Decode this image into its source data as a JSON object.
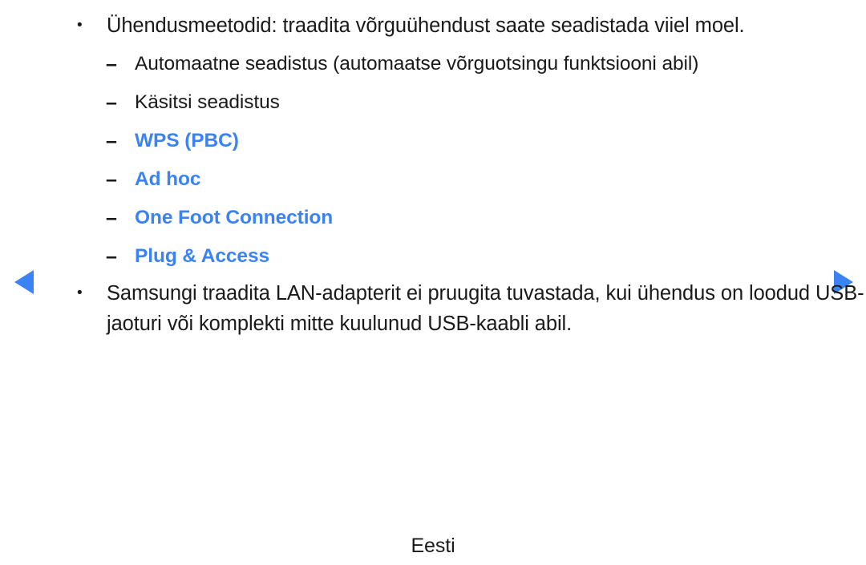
{
  "page": {
    "language_footer": "Eesti",
    "background_color": "#ffffff",
    "text_color": "#1a1a1a",
    "highlight_color": "#3b82f5"
  },
  "navigation": {
    "prev_icon": "triangle-left-icon",
    "next_icon": "triangle-right-icon"
  },
  "content": {
    "intro_bullet": {
      "marker": "•",
      "text": "Ühendusmeetodid: traadita võrguühendust saate seadistada viiel moel."
    },
    "sub_items": [
      {
        "marker": "–",
        "text": "Automaatne seadistus (automaatse võrguotsingu funktsiooni abil)",
        "highlighted": false
      },
      {
        "marker": "–",
        "text": "Käsitsi seadistus",
        "highlighted": false
      },
      {
        "marker": "–",
        "text": "WPS (PBC)",
        "highlighted": true
      },
      {
        "marker": "–",
        "text": "Ad hoc",
        "highlighted": true
      },
      {
        "marker": "–",
        "text": "One Foot Connection",
        "highlighted": true
      },
      {
        "marker": "–",
        "text": "Plug & Access",
        "highlighted": true
      }
    ],
    "note_bullet": {
      "marker": "•",
      "text": "Samsungi traadita LAN-adapterit ei pruugita tuvastada, kui ühendus on loodud USB-jaoturi või komplekti mitte kuulunud USB-kaabli abil."
    }
  }
}
